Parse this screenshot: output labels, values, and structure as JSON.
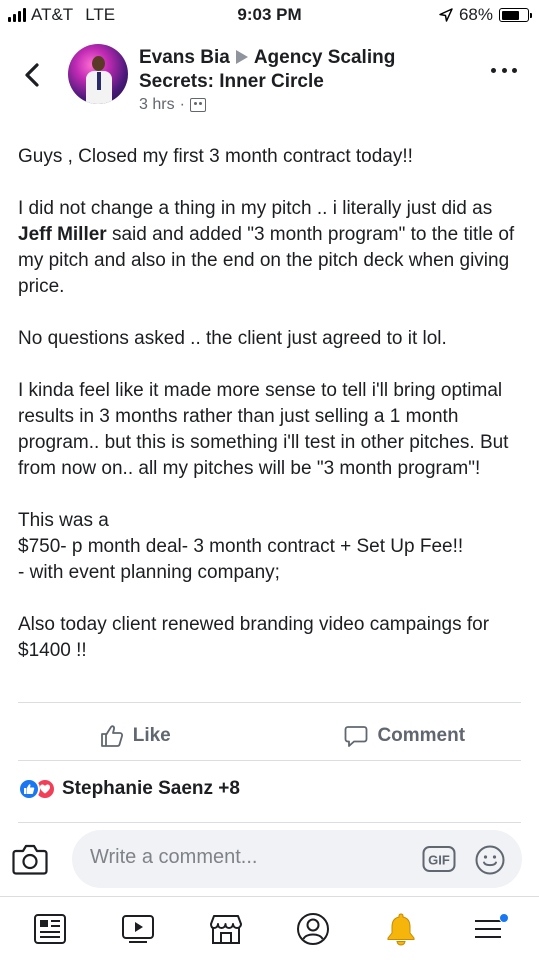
{
  "status_bar": {
    "carrier": "AT&T",
    "network": "LTE",
    "time": "9:03 PM",
    "battery": "68%",
    "battery_level": 0.68
  },
  "post": {
    "author": "Evans Bia",
    "group": "Agency Scaling Secrets: Inner Circle",
    "time_ago": "3 hrs",
    "dot": "·",
    "paragraphs": [
      "Guys , Closed my first 3 month contract today!!",
      "I did not change a thing in my pitch .. i literally just did as ",
      "No questions asked .. the client just agreed to it lol.",
      "I kinda feel like it made more sense to tell i'll bring optimal results in 3 months rather than just selling a 1 month program.. but this is something i'll test in other pitches. But from now on.. all my pitches will be \"3 month program\"!",
      "This was a",
      "$750- p month deal- 3 month contract  + Set Up Fee!!",
      "- with event planning company;",
      "Also today client renewed branding video campaings for $1400 !!"
    ],
    "mention": "Jeff Miller",
    "mention_after": " said and added \"3 month program\" to the title of my pitch and also in the end on the pitch deck when giving price."
  },
  "actions": {
    "like_label": "Like",
    "comment_label": "Comment"
  },
  "reactions": {
    "names": "Stephanie Saenz +8"
  },
  "composer": {
    "placeholder": "Write a comment...",
    "gif_label": "GIF"
  },
  "tabs": [
    "news-feed",
    "watch",
    "marketplace",
    "profile",
    "notifications",
    "menu"
  ],
  "colors": {
    "accent": "#1877f2",
    "love": "#f33e58",
    "notification_bell": "#f5b50a",
    "text": "#1c1e21",
    "muted": "#606770"
  }
}
